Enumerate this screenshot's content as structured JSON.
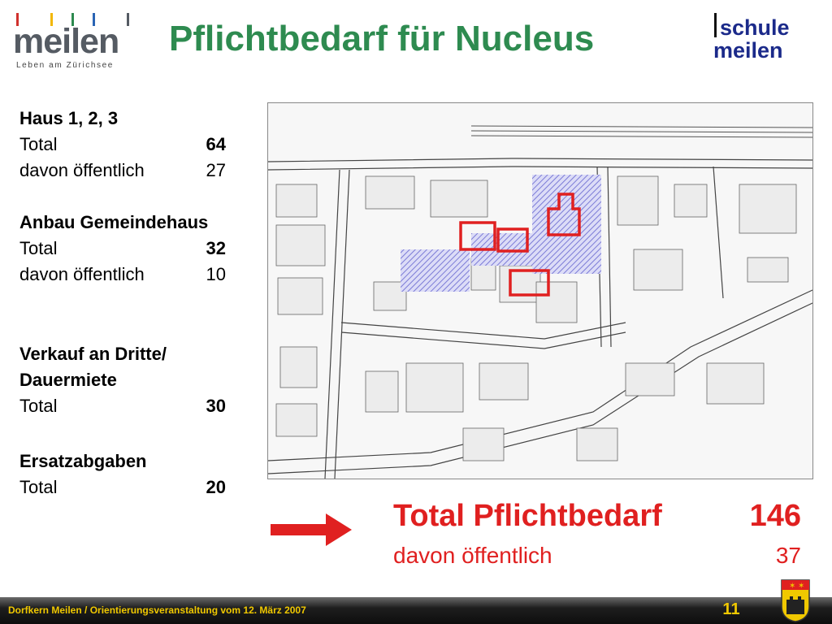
{
  "header": {
    "title": "Pflichtbedarf für Nucleus",
    "logo_meilen": {
      "word": "meilen",
      "tagline": "Leben am Zürichsee"
    },
    "logo_schule": {
      "line1": "schule",
      "line2": "meilen"
    }
  },
  "items": [
    {
      "heading": "Haus 1, 2, 3",
      "rows": [
        {
          "label": "Total",
          "value": "64"
        },
        {
          "label": "davon öffentlich",
          "value": "27"
        }
      ]
    },
    {
      "heading": "Anbau Gemeindehaus",
      "rows": [
        {
          "label": "Total",
          "value": "32"
        },
        {
          "label": "davon öffentlich",
          "value": "10"
        }
      ]
    },
    {
      "heading": "Verkauf an Dritte/ Dauermiete",
      "rows": [
        {
          "label": "Total",
          "value": "30"
        }
      ]
    },
    {
      "heading": "Ersatzabgaben",
      "rows": [
        {
          "label": "Total",
          "value": "20"
        }
      ]
    }
  ],
  "summary": {
    "total_label": "Total Pflichtbedarf",
    "total_value": "146",
    "public_label": "davon öffentlich",
    "public_value": "37"
  },
  "footer": {
    "text": "Dorfkern Meilen / Orientierungsveranstaltung vom 12. März 2007",
    "page": "11"
  },
  "colors": {
    "title": "#2e8b50",
    "accent_red": "#e02020",
    "brand_blue": "#1b2a8a",
    "footer_text": "#f0c800",
    "hatch": "#7b7bd6"
  }
}
